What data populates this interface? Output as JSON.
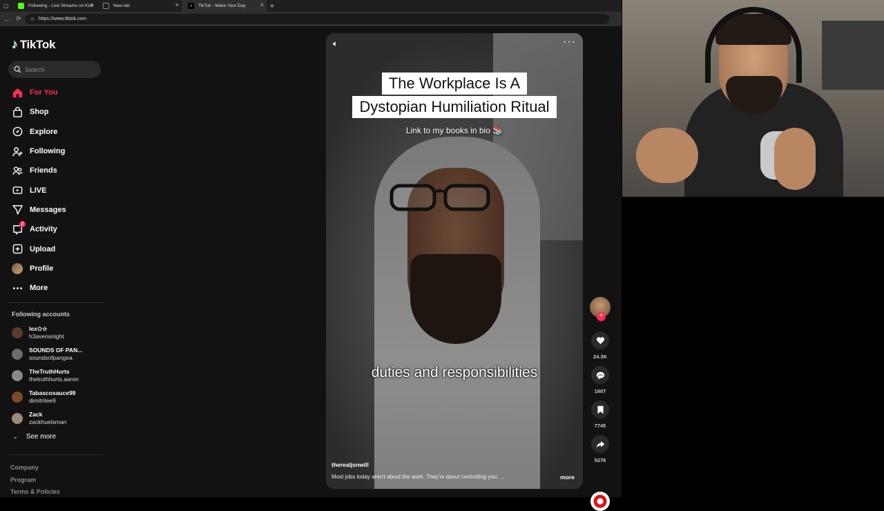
{
  "browser": {
    "tabs": [
      {
        "label": "Following - Live Streams on Kick",
        "fav_color": "#53fc18",
        "active": false
      },
      {
        "label": "New tab",
        "fav_color": "#888888",
        "active": false
      },
      {
        "label": "TikTok - Make Your Day",
        "fav_color": "#000000",
        "active": true
      }
    ],
    "new_tab_icon": "plus-icon",
    "url": "https://www.tiktok.com"
  },
  "brand": {
    "name": "TikTok"
  },
  "search": {
    "placeholder": "Search"
  },
  "nav": [
    {
      "label": "For You",
      "icon": "home-icon",
      "active": true
    },
    {
      "label": "Shop",
      "icon": "shop-icon"
    },
    {
      "label": "Explore",
      "icon": "compass-icon"
    },
    {
      "label": "Following",
      "icon": "person-plus-icon"
    },
    {
      "label": "Friends",
      "icon": "friends-icon"
    },
    {
      "label": "LIVE",
      "icon": "live-icon"
    },
    {
      "label": "Messages",
      "icon": "send-icon"
    },
    {
      "label": "Activity",
      "icon": "activity-icon",
      "badge": "2"
    },
    {
      "label": "Upload",
      "icon": "upload-icon"
    },
    {
      "label": "Profile",
      "icon": "avatar"
    },
    {
      "label": "More",
      "icon": "more-dots-icon"
    }
  ],
  "following_accounts": {
    "title": "Following accounts",
    "accounts": [
      {
        "nickname": "lex✩☆",
        "username": "h3avensnight",
        "color": "#5a3a2a"
      },
      {
        "nickname": "SOUNDS OF PAN...",
        "username": "soundsofpangea",
        "color": "#6b6b6b"
      },
      {
        "nickname": "TheTruthHurts",
        "username": "thetruthhurts.aaron",
        "color": "#8a8a8a"
      },
      {
        "nickname": "Tabascosauce99",
        "username": "dimitrilee9",
        "color": "#7a4a2a"
      },
      {
        "nickname": "Zack",
        "username": "zackhuelsman",
        "color": "#9a8a7a"
      }
    ],
    "see_more": "See more"
  },
  "footer": [
    "Company",
    "Program",
    "Terms & Policies"
  ],
  "video": {
    "caption_lines": [
      "The Workplace Is A",
      "Dystopian Humiliation Ritual"
    ],
    "link_bio": "Link to my books in bio 📚",
    "subtitle": "duties and responsibilities",
    "author": "therealjsnwill",
    "description": "Most jobs today aren't about the work. They're about controlling you. ...",
    "more_label": "more"
  },
  "actions": {
    "likes": "24.3K",
    "comments": "1607",
    "saves": "7745",
    "shares": "5276"
  },
  "colors": {
    "accent": "#fe2c55",
    "bg": "#121212"
  }
}
